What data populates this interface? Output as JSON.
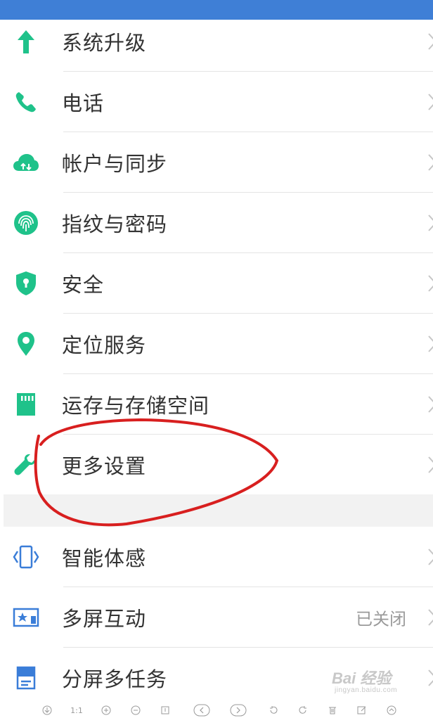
{
  "colors": {
    "topbar": "#3f7fd6",
    "green_icon": "#1fc28a",
    "blue_icon": "#3a7dd8",
    "annotation": "#d81f1f"
  },
  "settings_group_1": [
    {
      "label": "系统升级",
      "icon": "arrow-up-icon"
    },
    {
      "label": "电话",
      "icon": "phone-icon"
    },
    {
      "label": "帐户与同步",
      "icon": "cloud-sync-icon"
    },
    {
      "label": "指纹与密码",
      "icon": "fingerprint-icon"
    },
    {
      "label": "安全",
      "icon": "shield-icon"
    },
    {
      "label": "定位服务",
      "icon": "location-pin-icon"
    },
    {
      "label": "运存与存储空间",
      "icon": "sd-card-icon"
    },
    {
      "label": "更多设置",
      "icon": "wrench-icon"
    }
  ],
  "settings_group_2": [
    {
      "label": "智能体感",
      "icon": "motion-phone-icon",
      "value": ""
    },
    {
      "label": "多屏互动",
      "icon": "screen-cast-icon",
      "value": "已关闭"
    },
    {
      "label": "分屏多任务",
      "icon": "split-screen-icon",
      "value": ""
    }
  ],
  "watermark": {
    "main": "Bai 经验",
    "sub": "jingyan.baidu.com"
  },
  "bottom_toolbar": {
    "zoom_reset_label": "1:1"
  }
}
